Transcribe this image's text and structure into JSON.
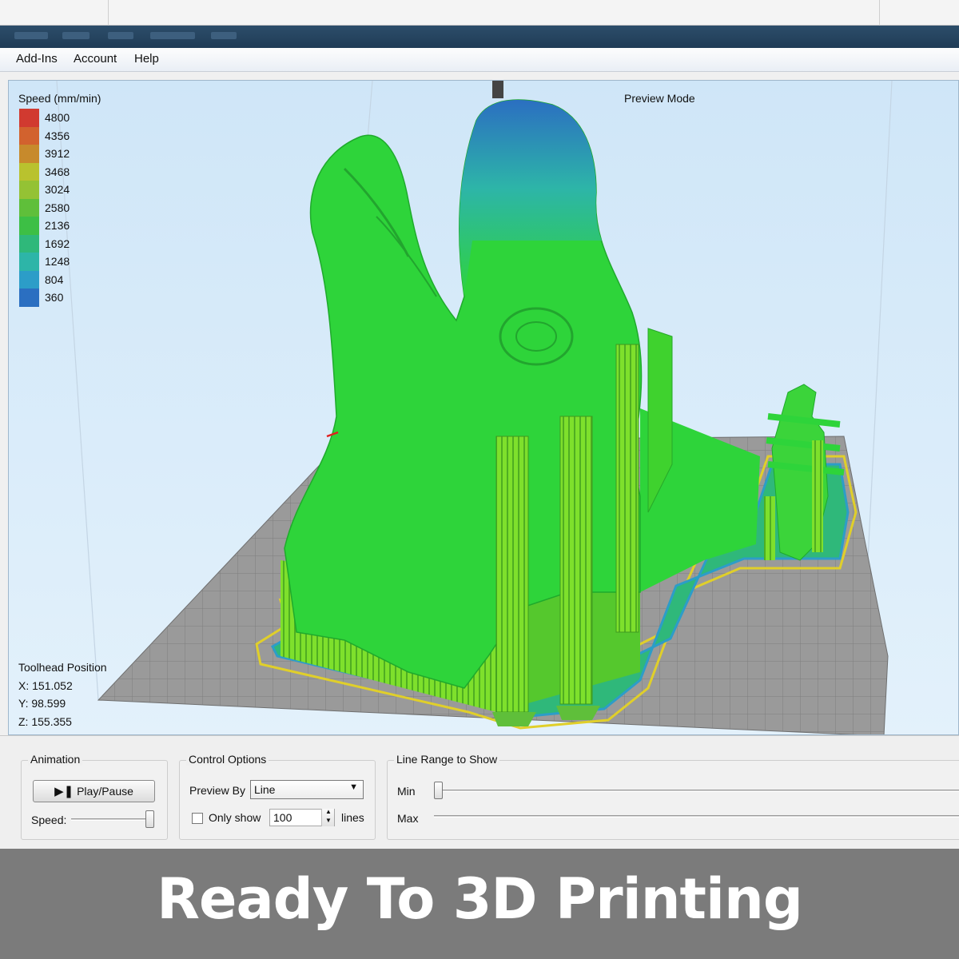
{
  "menu": {
    "items": [
      "Add-Ins",
      "Account",
      "Help"
    ]
  },
  "viewport": {
    "mode_label": "Preview Mode",
    "legend": {
      "title": "Speed (mm/min)",
      "entries": [
        {
          "value": "4800",
          "color": "#d13a30"
        },
        {
          "value": "4356",
          "color": "#d2622e"
        },
        {
          "value": "3912",
          "color": "#c78a2c"
        },
        {
          "value": "3468",
          "color": "#b9c22e"
        },
        {
          "value": "3024",
          "color": "#94c234"
        },
        {
          "value": "2580",
          "color": "#5fbf3a"
        },
        {
          "value": "2136",
          "color": "#3dbf45"
        },
        {
          "value": "1692",
          "color": "#2fb87a"
        },
        {
          "value": "1248",
          "color": "#2db5a8"
        },
        {
          "value": "804",
          "color": "#2c9dc8"
        },
        {
          "value": "360",
          "color": "#2b6fc1"
        }
      ]
    },
    "toolhead": {
      "title": "Toolhead Position",
      "x": "X: 151.052",
      "y": "Y: 98.599",
      "z": "Z: 155.355"
    }
  },
  "animation": {
    "title": "Animation",
    "play_pause_label": "Play/Pause",
    "speed_label": "Speed:",
    "speed_level": 1.0
  },
  "control_options": {
    "title": "Control Options",
    "preview_by_label": "Preview By",
    "preview_by_value": "Line",
    "only_show_label": "Only show",
    "only_show_checked": false,
    "lines_value": "100",
    "lines_label": "lines"
  },
  "line_range": {
    "title": "Line Range to Show",
    "min_label": "Min",
    "max_label": "Max",
    "min_level": 0.0,
    "max_level": 1.0
  },
  "banner": {
    "text": "Ready To 3D Printing"
  },
  "colors": {
    "model_green": "#2ed43a",
    "support_green": "#7ee02c",
    "bed_gray": "#9a9a9a",
    "sky": "#cfe6f8",
    "banner_gray": "#7b7b7b"
  }
}
